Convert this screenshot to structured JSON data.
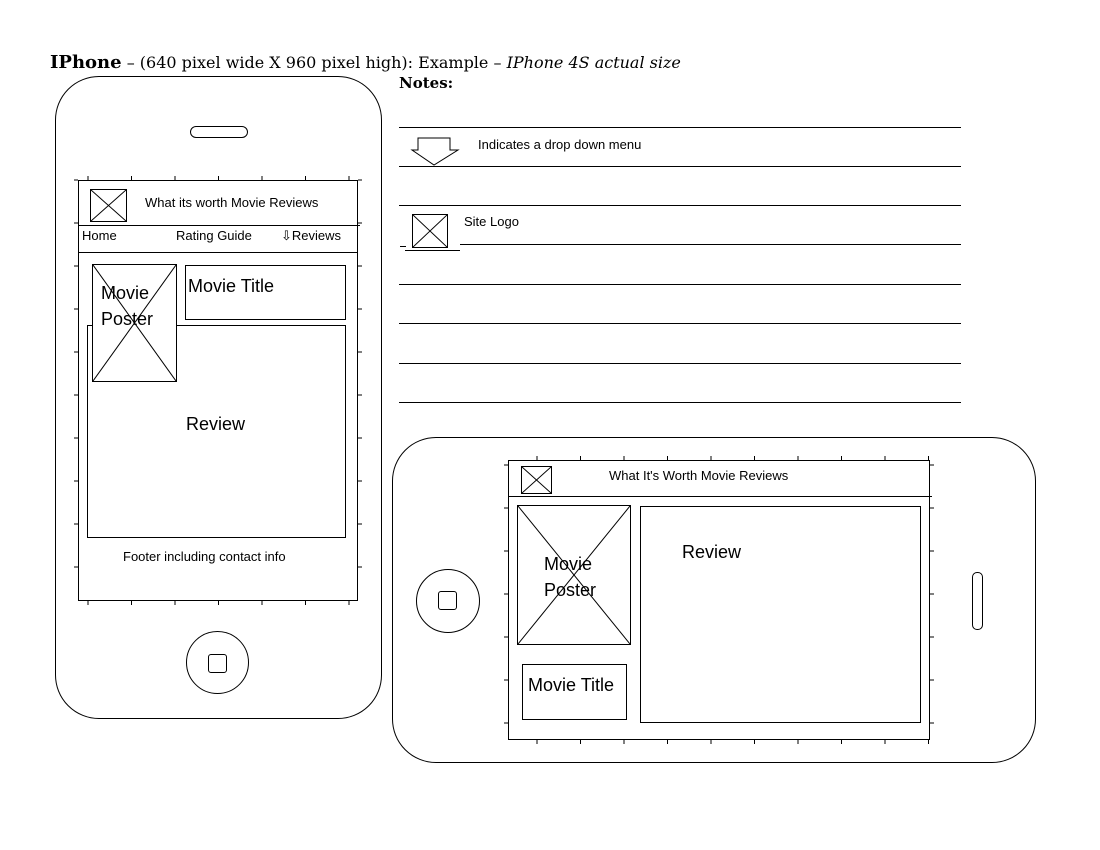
{
  "heading": {
    "device": "IPhone",
    "spec": "– (640 pixel wide X 960 pixel high): Example –",
    "example": "IPhone 4S actual size"
  },
  "notes": {
    "label": "Notes:",
    "dropdown_text": "Indicates a drop down menu",
    "logo_text": "Site Logo"
  },
  "portrait": {
    "header_title": "What its worth Movie Reviews",
    "nav": {
      "home": "Home",
      "rating_guide": "Rating Guide",
      "reviews": "Reviews"
    },
    "poster_label_1": "Movie",
    "poster_label_2": "Poster",
    "movie_title": "Movie Title",
    "review": "Review",
    "footer": "Footer including contact info"
  },
  "landscape": {
    "header_title": "What It's Worth Movie Reviews",
    "poster_label_1": "Movie",
    "poster_label_2": "Poster",
    "review": "Review",
    "movie_title": "Movie Title"
  },
  "glyphs": {
    "dropdown_arrow": "⇩"
  }
}
